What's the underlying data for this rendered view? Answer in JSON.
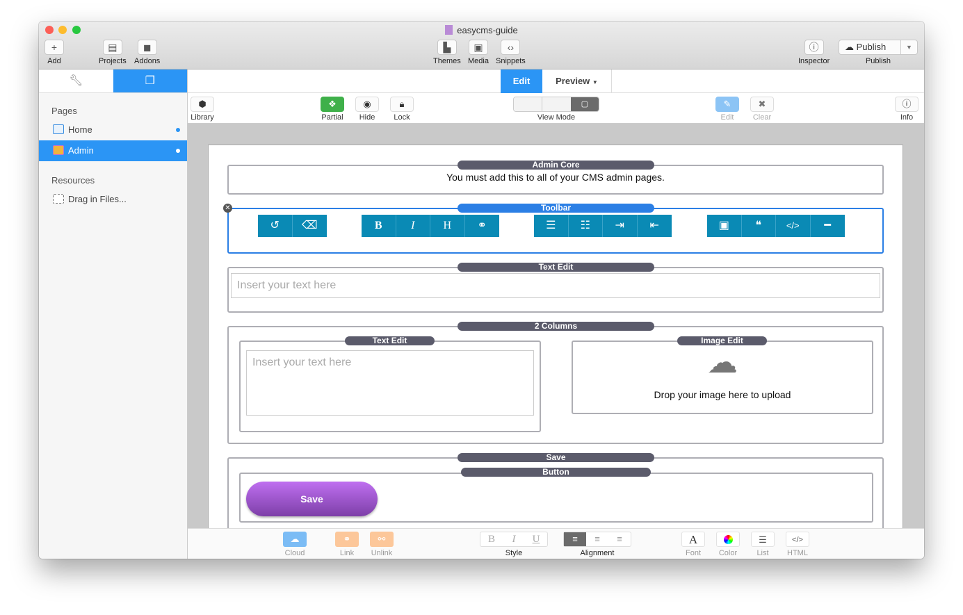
{
  "window": {
    "title": "easycms-guide"
  },
  "toolbar": {
    "add": "Add",
    "projects": "Projects",
    "addons": "Addons",
    "themes": "Themes",
    "media": "Media",
    "snippets": "Snippets",
    "inspector": "Inspector",
    "publish_button": "Publish",
    "publish": "Publish"
  },
  "sidebar": {
    "pages_header": "Pages",
    "pages": [
      {
        "label": "Home"
      },
      {
        "label": "Admin"
      }
    ],
    "resources_header": "Resources",
    "drag": "Drag in Files..."
  },
  "tabs": {
    "edit": "Edit",
    "preview": "Preview"
  },
  "edit_toolbar": {
    "library": "Library",
    "partial": "Partial",
    "hide": "Hide",
    "lock": "Lock",
    "view_mode": "View Mode",
    "edit": "Edit",
    "clear": "Clear",
    "info": "Info"
  },
  "canvas": {
    "admin_core": {
      "label": "Admin Core",
      "text": "You must add this to all of your CMS admin pages."
    },
    "toolbar_block": {
      "label": "Toolbar",
      "buttons": [
        "B",
        "I",
        "H"
      ]
    },
    "text_edit": {
      "label": "Text Edit",
      "placeholder": "Insert your text here"
    },
    "two_columns": {
      "label": "2 Columns",
      "text_edit_label": "Text Edit",
      "placeholder": "Insert your text here",
      "image_edit_label": "Image Edit",
      "image_text": "Drop your image here to upload"
    },
    "save": {
      "label": "Save",
      "button_label": "Button",
      "button_text": "Save"
    }
  },
  "bottom": {
    "cloud": "Cloud",
    "link": "Link",
    "unlink": "Unlink",
    "style_buttons": [
      "B",
      "I",
      "U"
    ],
    "style": "Style",
    "alignment": "Alignment",
    "font_glyph": "A",
    "font": "Font",
    "color": "Color",
    "list": "List",
    "html": "HTML"
  },
  "colors": {
    "accent": "#2b95f5",
    "cms_button": "#0a8ab5",
    "block_label": "#5b5b6b",
    "save_button": "#9b4fd0"
  }
}
